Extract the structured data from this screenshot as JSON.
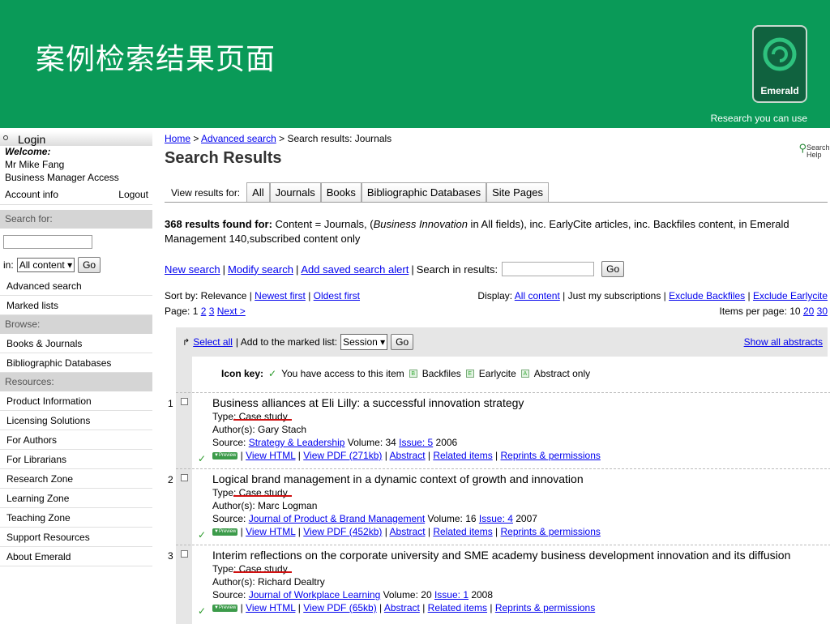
{
  "slide": {
    "title": "案例检索结果页面",
    "logo_text": "Emerald",
    "tagline": "Research you can use",
    "colors": {
      "banner": "#0a9a58",
      "logo_bg": "#10623f"
    }
  },
  "sidebar": {
    "login": "Login",
    "welcome": "Welcome:",
    "user": "Mr Mike Fang",
    "access": "Business Manager Access",
    "account": "Account info",
    "logout": "Logout",
    "search_for": "Search for:",
    "in_label": "in:",
    "in_value": "All content",
    "go": "Go",
    "links1": [
      "Advanced search",
      "Marked lists"
    ],
    "browse": "Browse:",
    "browse_items": [
      "Books & Journals",
      "Bibliographic Databases"
    ],
    "resources": "Resources:",
    "resource_items": [
      "Product Information",
      "Licensing Solutions",
      "For Authors",
      "For Librarians",
      "Research Zone",
      "Learning Zone",
      "Teaching Zone",
      "Support Resources",
      "About Emerald"
    ]
  },
  "main": {
    "crumb_home": "Home",
    "crumb_sep1": " > ",
    "crumb_adv": "Advanced search",
    "crumb_tail": " > Search results: Journals",
    "title": "Search Results",
    "help": "Search Help",
    "view_label": "View results for:",
    "tabs": [
      "All",
      "Journals",
      "Books",
      "Bibliographic Databases",
      "Site Pages"
    ],
    "count_bold": "368 results found for:",
    "count_a": " Content = Journals, (",
    "count_em": "Business Innovation",
    "count_b": " in All fields), inc. EarlyCite articles, inc. Backfiles content, in Emerald Management 140,subscribed content only",
    "new_search": "New search",
    "modify_search": "Modify search",
    "add_alert": "Add saved search alert",
    "search_in": "Search in results:",
    "go": "Go",
    "sort_label": "Sort by: Relevance | ",
    "sort_newest": "Newest first",
    "sort_oldest": "Oldest first",
    "display_label": "Display: ",
    "display_all": "All content",
    "display_mine": " | Just my subscriptions | ",
    "excl_back": "Exclude Backfiles",
    "excl_early": "Exclude Earlycite",
    "page_label": "Page: 1 ",
    "page2": "2",
    "page3": "3",
    "next": "Next >",
    "ipp_label": "Items per page: 10 ",
    "ipp20": "20",
    "ipp30": "30",
    "select_all": "Select all",
    "add_marked": "| Add to the marked list:",
    "session": "Session",
    "show_abstracts": "Show all abstracts",
    "icon_key": "Icon key:",
    "key_access": "You have access to this item",
    "key_b": "B",
    "key_back": "Backfiles",
    "key_e": "E",
    "key_early": "Earlycite",
    "key_a": "A",
    "key_abs": "Abstract only",
    "preview": "▼Preview",
    "link_html": "View HTML",
    "link_related": "Related items",
    "link_reprints": "Reprints & permissions",
    "link_abstract": "Abstract",
    "results": [
      {
        "num": "1",
        "title": "Business alliances at Eli Lilly: a successful innovation strategy",
        "type": "Type: Case study",
        "author": "Author(s): Gary Stach",
        "source_label": "Source: ",
        "journal": "Strategy & Leadership",
        "vol": " Volume: 34 ",
        "issue": "Issue: 5",
        "year": " 2006",
        "pdf": "View PDF (271kb)"
      },
      {
        "num": "2",
        "title": "Logical brand management in a dynamic context of growth and innovation",
        "type": "Type: Case study",
        "author": "Author(s): Marc Logman",
        "source_label": "Source: ",
        "journal": "Journal of Product & Brand Management",
        "vol": " Volume: 16 ",
        "issue": "Issue: 4",
        "year": " 2007",
        "pdf": "View PDF (452kb)"
      },
      {
        "num": "3",
        "title": "Interim reflections on the corporate university and SME academy business development innovation and its diffusion",
        "type": "Type: Case study",
        "author": "Author(s): Richard Dealtry",
        "source_label": "Source: ",
        "journal": "Journal of Workplace Learning",
        "vol": " Volume: 20 ",
        "issue": "Issue: 1",
        "year": " 2008",
        "pdf": "View PDF (65kb)"
      }
    ]
  }
}
